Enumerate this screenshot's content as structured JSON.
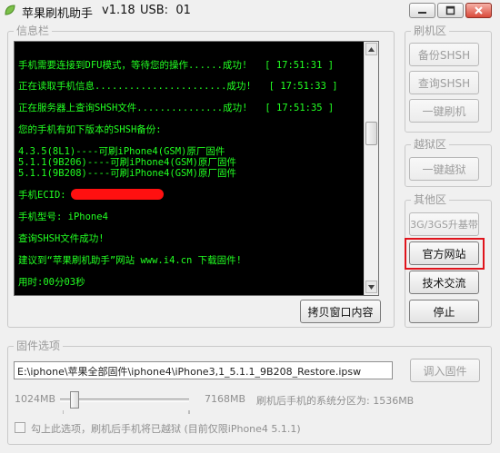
{
  "title": {
    "app_name": "苹果刷机助手",
    "version": "v1.18",
    "usb": "USB:  01"
  },
  "window_controls": [
    "minimize-icon",
    "maximize-icon",
    "close-icon"
  ],
  "info_panel": {
    "title": "信息栏",
    "console_lines": [
      "手机需要连接到DFU模式，等待您的操作......成功!   [ 17:51:31 ]",
      "正在读取手机信息.......................成功!   [ 17:51:33 ]",
      "正在服务器上查询SHSH文件...............成功!   [ 17:51:35 ]",
      "您的手机有如下版本的SHSH备份:",
      "4.3.5(8L1)----可刷iPhone4(GSM)原厂固件",
      "5.1.1(9B206)----可刷iPhone4(GSM)原厂固件",
      "5.1.1(9B208)----可刷iPhone4(GSM)原厂固件",
      "手机ECID:",
      "手机型号: iPhone4",
      "查询SHSH文件成功!",
      "建议到“苹果刷机助手”网站 www.i4.cn 下载固件!",
      "用时:00分03秒"
    ],
    "copy_button": "拷贝窗口内容"
  },
  "flash_group": {
    "title": "刷机区",
    "backup_shsh": "备份SHSH",
    "query_shsh": "查询SHSH",
    "one_click_flash": "一键刷机"
  },
  "jailbreak_group": {
    "title": "越狱区",
    "one_click_jailbreak": "一键越狱"
  },
  "other_group": {
    "title": "其他区",
    "baseband_upgrade": "3G/3GS升基带",
    "official_site": "官方网站",
    "tech_exchange": "技术交流",
    "stop": "停止"
  },
  "firmware_group": {
    "title": "固件选项",
    "path": "E:\\iphone\\苹果全部固件\\iphone4\\iPhone3,1_5.1.1_9B208_Restore.ipsw",
    "import_button": "调入固件",
    "min_size": "1024MB",
    "max_size": "7168MB",
    "partition_text": "刷机后手机的系统分区为: 1536MB",
    "slider_fraction": 0.08,
    "jailbreak_checkbox_label": "勾上此选项，刷机后手机将已越狱 (目前仅限iPhone4 5.1.1)",
    "jailbreak_checked": false
  },
  "colors": {
    "console_bg": "#000000",
    "console_text": "#22ff22",
    "highlight": "#e0141c"
  }
}
